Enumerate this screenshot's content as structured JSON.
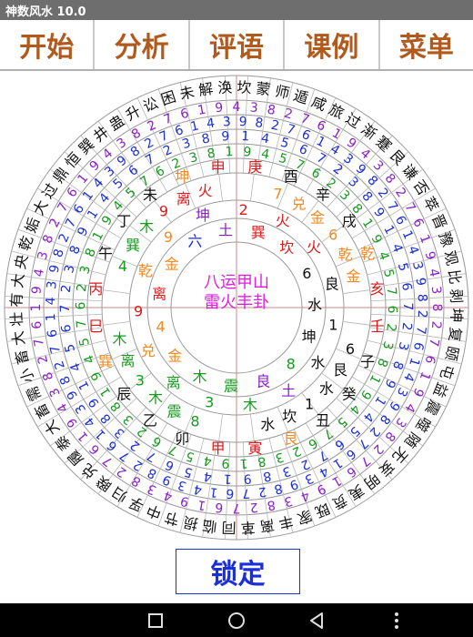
{
  "app": {
    "title": "神数风水 10.0"
  },
  "tabs": [
    "开始",
    "分析",
    "评语",
    "课例",
    "菜单"
  ],
  "lock_button": "锁定",
  "center": {
    "line1": "八运甲山",
    "line2": "雷火丰卦"
  },
  "colors": {
    "tab_text": "#b05a1e",
    "red": "#e0191b",
    "orange": "#f08a24",
    "green": "#159a1c",
    "blue": "#1b2fd6",
    "purple": "#8a1fc9",
    "magenta": "#e21de0",
    "black": "#111111"
  },
  "wheel": {
    "hexagrams": [
      "解",
      "涣",
      "坎",
      "蒙",
      "师",
      "遁",
      "咸",
      "旅",
      "过",
      "渐",
      "蹇",
      "艮",
      "谦",
      "否",
      "萃",
      "晋",
      "豫",
      "观",
      "比",
      "剥",
      "坤",
      "复",
      "颐",
      "屯",
      "益",
      "震",
      "噬",
      "随",
      "无",
      "妄",
      "明",
      "夷",
      "贲",
      "既",
      "家",
      "丰",
      "离",
      "革",
      "同",
      "临",
      "损",
      "节",
      "中",
      "孚",
      "归",
      "睽",
      "兑",
      "履",
      "泰",
      "大",
      "畜",
      "需",
      "小",
      "畜",
      "大",
      "壮",
      "有",
      "大",
      "央",
      "乾",
      "姤",
      "大",
      "过",
      "鼎",
      "恒",
      "巽",
      "井",
      "蛊",
      "升",
      "讼",
      "困",
      "未"
    ],
    "ring_outer_purple": [
      "4",
      "3",
      "8",
      "2",
      "7",
      "6",
      "1",
      "9",
      "4",
      "3",
      "8",
      "2",
      "7",
      "6",
      "1",
      "9",
      "4",
      "3",
      "8",
      "2",
      "7",
      "6",
      "1",
      "9",
      "4",
      "3",
      "8",
      "2",
      "7",
      "6",
      "1",
      "9",
      "4",
      "3",
      "8",
      "2",
      "7",
      "6",
      "1",
      "9",
      "4",
      "3",
      "8",
      "2",
      "7",
      "6",
      "1",
      "9",
      "4",
      "3",
      "8",
      "2",
      "7",
      "6",
      "1",
      "9",
      "4",
      "3",
      "8",
      "2",
      "7",
      "6",
      "1",
      "9",
      "4",
      "3",
      "8",
      "2",
      "7",
      "6",
      "1",
      "9"
    ],
    "ring_blue_a": [
      "9",
      "8",
      "2",
      "7",
      "6",
      "1",
      "4",
      "3",
      "9",
      "8",
      "2",
      "7",
      "6",
      "1",
      "4",
      "3",
      "9",
      "8",
      "2",
      "7",
      "6",
      "1",
      "4",
      "3",
      "9",
      "8",
      "2",
      "7",
      "6",
      "1",
      "4",
      "3",
      "9",
      "8",
      "2",
      "7",
      "6",
      "1",
      "4",
      "3",
      "9",
      "8",
      "2",
      "7",
      "6",
      "1",
      "4",
      "3",
      "9",
      "8",
      "2",
      "7",
      "6",
      "1",
      "4",
      "3",
      "9",
      "8",
      "2",
      "7",
      "6",
      "1",
      "4",
      "3",
      "9",
      "8",
      "2",
      "7",
      "6",
      "1",
      "4",
      "3"
    ],
    "ring_blue_b": [
      "1",
      "4",
      "5",
      "6",
      "7",
      "2",
      "3",
      "8",
      "9",
      "1",
      "4",
      "5",
      "6",
      "7",
      "2",
      "3",
      "8",
      "9",
      "1",
      "4",
      "5",
      "6",
      "7",
      "2",
      "3",
      "8",
      "9",
      "1",
      "4",
      "5",
      "6",
      "7",
      "2",
      "3",
      "8",
      "9",
      "1",
      "4",
      "5",
      "6",
      "7",
      "2",
      "3",
      "8",
      "9",
      "1",
      "4",
      "5",
      "6",
      "7",
      "2",
      "3",
      "8",
      "9"
    ],
    "ring_green": [
      "9",
      "4",
      "5",
      "7",
      "6",
      "2",
      "3",
      "8",
      "1",
      "9",
      "4",
      "5",
      "7",
      "6",
      "2",
      "3",
      "8",
      "1",
      "9",
      "4",
      "5",
      "7",
      "6",
      "2",
      "3",
      "8",
      "1",
      "9",
      "4",
      "5",
      "7",
      "6",
      "2",
      "3",
      "8",
      "1",
      "9",
      "4",
      "5",
      "7",
      "6",
      "2",
      "3",
      "8",
      "1",
      "9",
      "4",
      "5",
      "7",
      "6",
      "2",
      "3",
      "8",
      "1"
    ],
    "mountains": [
      {
        "t": "庚",
        "c": "red"
      },
      {
        "t": "酉",
        "c": "black"
      },
      {
        "t": "辛",
        "c": "black"
      },
      {
        "t": "戌",
        "c": "black"
      },
      {
        "t": "乾",
        "c": "orange"
      },
      {
        "t": "亥",
        "c": "red"
      },
      {
        "t": "壬",
        "c": "red"
      },
      {
        "t": "子",
        "c": "black"
      },
      {
        "t": "癸",
        "c": "black"
      },
      {
        "t": "丑",
        "c": "black"
      },
      {
        "t": "艮",
        "c": "orange"
      },
      {
        "t": "寅",
        "c": "red"
      },
      {
        "t": "甲",
        "c": "red"
      },
      {
        "t": "卯",
        "c": "black"
      },
      {
        "t": "乙",
        "c": "black"
      },
      {
        "t": "辰",
        "c": "black"
      },
      {
        "t": "巽",
        "c": "orange"
      },
      {
        "t": "巳",
        "c": "red"
      },
      {
        "t": "丙",
        "c": "red"
      },
      {
        "t": "午",
        "c": "black"
      },
      {
        "t": "丁",
        "c": "black"
      },
      {
        "t": "未",
        "c": "black"
      },
      {
        "t": "坤",
        "c": "orange"
      },
      {
        "t": "申",
        "c": "red"
      }
    ],
    "palaces": [
      {
        "items": [
          {
            "t": "7",
            "c": "orange"
          },
          {
            "t": "兑",
            "c": "orange"
          },
          {
            "t": "金",
            "c": "orange"
          },
          {
            "t": "6",
            "c": "orange"
          },
          {
            "t": "乾",
            "c": "orange"
          },
          {
            "t": "金",
            "c": "orange"
          }
        ]
      },
      {
        "items": [
          {
            "t": "6",
            "c": "black"
          },
          {
            "t": "艮",
            "c": "black"
          },
          {
            "t": "水",
            "c": "black"
          },
          {
            "t": "1",
            "c": "black"
          },
          {
            "t": "坎",
            "c": "black"
          },
          {
            "t": "水",
            "c": "black"
          }
        ]
      },
      {
        "items": [
          {
            "t": "8",
            "c": "green"
          },
          {
            "t": "震",
            "c": "green"
          },
          {
            "t": "木",
            "c": "green"
          },
          {
            "t": "3",
            "c": "green"
          },
          {
            "t": "离",
            "c": "green"
          },
          {
            "t": "木",
            "c": "green"
          }
        ]
      },
      {
        "items": [
          {
            "t": "4",
            "c": "green"
          },
          {
            "t": "巽",
            "c": "green"
          },
          {
            "t": "木",
            "c": "green"
          },
          {
            "t": "9",
            "c": "red"
          },
          {
            "t": "离",
            "c": "red"
          },
          {
            "t": "火",
            "c": "red"
          }
        ]
      }
    ],
    "inner_text": [
      {
        "t": "坤",
        "c": "purple"
      },
      {
        "t": "土",
        "c": "purple"
      },
      {
        "t": "2",
        "c": "red"
      },
      {
        "t": "巽",
        "c": "red"
      },
      {
        "t": "火",
        "c": "red"
      },
      {
        "t": "坎",
        "c": "red"
      },
      {
        "t": "火",
        "c": "red"
      },
      {
        "t": "6",
        "c": "black"
      },
      {
        "t": "良",
        "c": "black"
      },
      {
        "t": "水",
        "c": "black"
      },
      {
        "t": "1",
        "c": "black"
      },
      {
        "t": "坤",
        "c": "black"
      },
      {
        "t": "水",
        "c": "black"
      },
      {
        "t": "8",
        "c": "green"
      },
      {
        "t": "土",
        "c": "purple"
      },
      {
        "t": "良",
        "c": "purple"
      },
      {
        "t": "木",
        "c": "green"
      },
      {
        "t": "震",
        "c": "green"
      },
      {
        "t": "3",
        "c": "green"
      },
      {
        "t": "木",
        "c": "green"
      },
      {
        "t": "离",
        "c": "green"
      },
      {
        "t": "金",
        "c": "orange"
      },
      {
        "t": "兑",
        "c": "orange"
      },
      {
        "t": "4",
        "c": "orange"
      },
      {
        "t": "9",
        "c": "red"
      },
      {
        "t": "离",
        "c": "red"
      },
      {
        "t": "乾",
        "c": "orange"
      },
      {
        "t": "金",
        "c": "orange"
      },
      {
        "t": "9",
        "c": "orange"
      },
      {
        "t": "六",
        "c": "blue"
      }
    ]
  }
}
